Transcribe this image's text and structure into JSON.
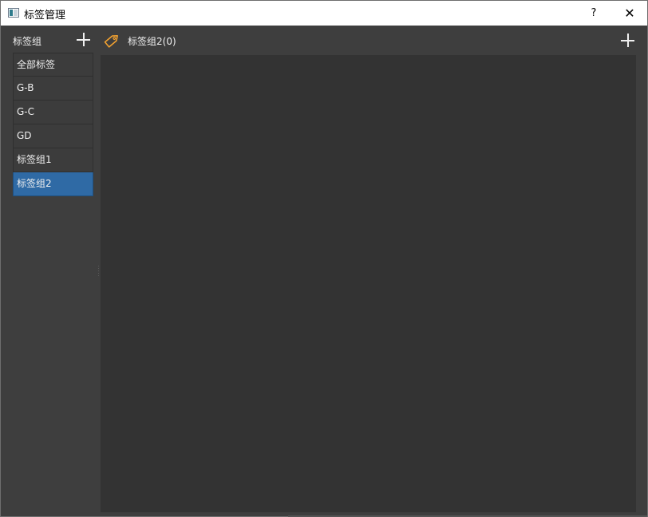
{
  "window": {
    "title": "标签管理",
    "help_label": "?",
    "close_label": "✕"
  },
  "left_panel": {
    "title": "标签组",
    "groups": [
      {
        "label": "全部标签",
        "selected": false
      },
      {
        "label": "G-B",
        "selected": false
      },
      {
        "label": "G-C",
        "selected": false
      },
      {
        "label": "GD",
        "selected": false
      },
      {
        "label": "标签组1",
        "selected": false
      },
      {
        "label": "标签组2",
        "selected": true
      }
    ]
  },
  "right_panel": {
    "current_group_label": "标签组2(0)",
    "icon": "tag-icon"
  },
  "colors": {
    "background": "#3e3e3e",
    "content_background": "#333333",
    "selection": "#2f6aa5",
    "tag_icon": "#f0a030"
  }
}
